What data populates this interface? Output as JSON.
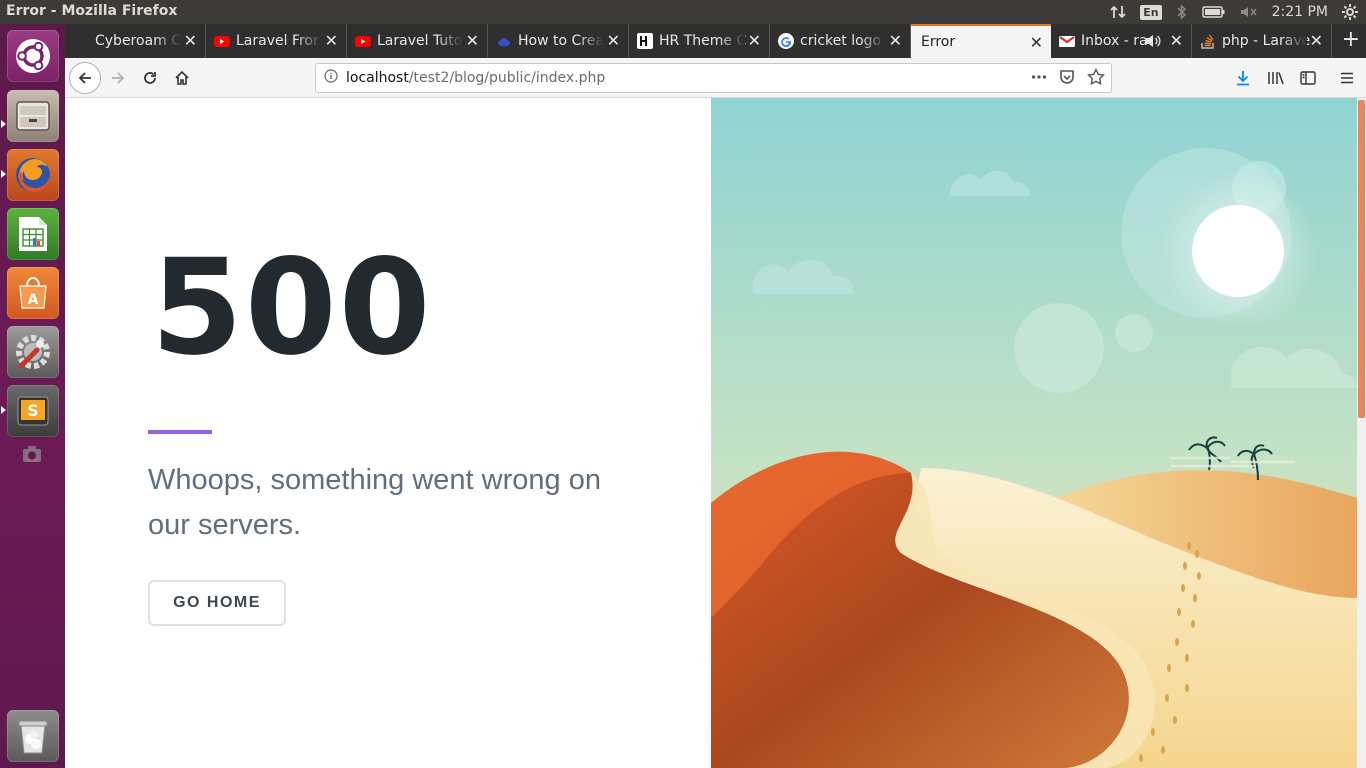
{
  "window": {
    "title": "Error - Mozilla Firefox"
  },
  "top_panel": {
    "lang": "En",
    "time": "2:21 PM"
  },
  "launcher": {
    "items": [
      "ubuntu-dash",
      "files",
      "firefox",
      "libreoffice-calc",
      "software-center",
      "system-settings",
      "sublime-text",
      "screenshot",
      "trash"
    ]
  },
  "tabs": [
    {
      "label": "Cyberoam C",
      "favicon": "cyberoam-icon"
    },
    {
      "label": "Laravel Fror",
      "favicon": "youtube-icon"
    },
    {
      "label": "Laravel Tuto",
      "favicon": "youtube-icon"
    },
    {
      "label": "How to Crea",
      "favicon": "cloud-icon"
    },
    {
      "label": "HR Theme C",
      "favicon": "hr-icon"
    },
    {
      "label": "cricket logo",
      "favicon": "google-icon"
    },
    {
      "label": "Error",
      "favicon": "",
      "active": true
    },
    {
      "label": "Inbox - ra",
      "favicon": "gmail-icon"
    },
    {
      "label": "php - Larave",
      "favicon": "stackoverflow-icon"
    }
  ],
  "nav": {
    "url_host": "localhost",
    "url_path": "/test2/blog/public/index.php"
  },
  "error_page": {
    "code": "500",
    "message": "Whoops, something went wrong on our servers.",
    "button": "GO HOME"
  },
  "colors": {
    "accent_divider": "#9561e2",
    "code_text": "#22292f",
    "message_text": "#606f7b",
    "launcher_bg": "#6d1a56",
    "firefox_active_tab": "#e87722"
  }
}
